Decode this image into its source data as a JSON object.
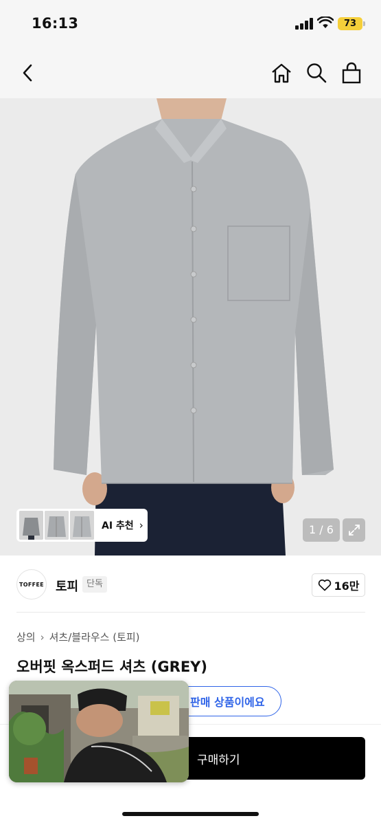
{
  "status": {
    "time": "16:13",
    "battery": "73"
  },
  "nav": {
    "back": "back-icon",
    "home": "home-icon",
    "search": "search-icon",
    "cart": "shopping-bag-icon"
  },
  "gallery": {
    "ai_label": "AI 추천",
    "counter": "1 / 6"
  },
  "brand": {
    "logo_text": "TOFFEE",
    "name": "토피",
    "badge": "단독",
    "likes": "16만"
  },
  "product": {
    "breadcrumb": [
      "상의",
      "셔츠/블라우스 (토피)"
    ],
    "title": "오버핏 옥스퍼드 셔츠 (GREY)"
  },
  "cta": {
    "resale_text": "판매 상품이에요",
    "buy_label": "구매하기"
  },
  "colors": {
    "accent_blue": "#2f64e8",
    "buy_bg": "#000000",
    "battery": "#f5cf3a"
  }
}
